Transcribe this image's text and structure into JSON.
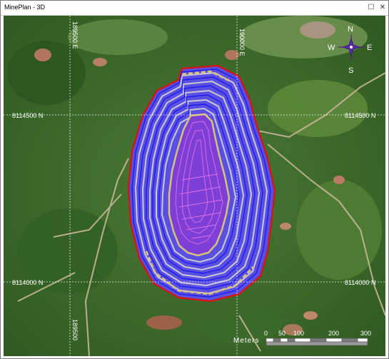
{
  "window": {
    "title": "MinePlan - 3D",
    "maximize_glyph": "☐",
    "close_glyph": "✕"
  },
  "map": {
    "grid_labels": {
      "north_1": "8114500 N",
      "north_2": "8114000 N",
      "east_1": "189500 E",
      "east_2": "190000 E",
      "bottom_easting": "189500"
    },
    "compass": {
      "n": "N",
      "s": "S",
      "e": "E",
      "w": "W"
    },
    "scale": {
      "unit": "Meters",
      "ticks": [
        "0",
        "50",
        "100",
        "200",
        "300"
      ]
    }
  },
  "colors": {
    "pit_outline": "#d01818",
    "bench": "#1d1df0",
    "berm": "#b9b9c6",
    "grid": "#ffffff",
    "ramp": "#d8c27a"
  }
}
